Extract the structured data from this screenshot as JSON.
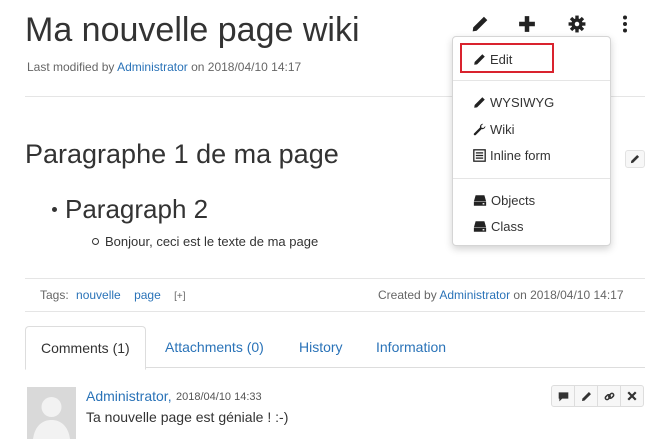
{
  "page": {
    "title": "Ma nouvelle page wiki",
    "meta_prefix": "Last modified by",
    "meta_user": "Administrator",
    "meta_on": "on 2018/04/10 14:17"
  },
  "toolbar": {
    "icons": [
      "pencil-icon",
      "plus-icon",
      "gear-icon",
      "vertical-dots-icon"
    ]
  },
  "content": {
    "heading": "Paragraphe 1 de ma page",
    "bullet_level1": "Paragraph 2",
    "bullet_level2": "Bonjour, ceci est le texte de ma page"
  },
  "footer": {
    "tags_label": "Tags:",
    "tags": [
      "nouvelle",
      "page"
    ],
    "tags_add": "[+]",
    "created_prefix": "Created by",
    "created_user": "Administrator",
    "created_on": "on 2018/04/10 14:17"
  },
  "tabs": [
    {
      "label": "Comments",
      "count": "(1)"
    },
    {
      "label": "Attachments",
      "count": "(0)"
    },
    {
      "label": "History",
      "count": ""
    },
    {
      "label": "Information",
      "count": ""
    }
  ],
  "comment": {
    "author": "Administrator,",
    "date": "2018/04/10 14:33",
    "text": "Ta nouvelle page est géniale ! :-)"
  },
  "edit_menu": {
    "items": [
      {
        "label": "Edit",
        "icon": "pencil-icon"
      },
      {
        "label": "WYSIWYG",
        "icon": "pencil-icon"
      },
      {
        "label": "Wiki",
        "icon": "wrench-icon"
      },
      {
        "label": "Inline form",
        "icon": "form-icon"
      },
      {
        "label": "Objects",
        "icon": "hdd-icon"
      },
      {
        "label": "Class",
        "icon": "hdd-icon"
      }
    ],
    "highlight_color": "#d9232e"
  },
  "colors": {
    "link": "#2a73b8",
    "text": "#333333",
    "muted": "#666666"
  }
}
